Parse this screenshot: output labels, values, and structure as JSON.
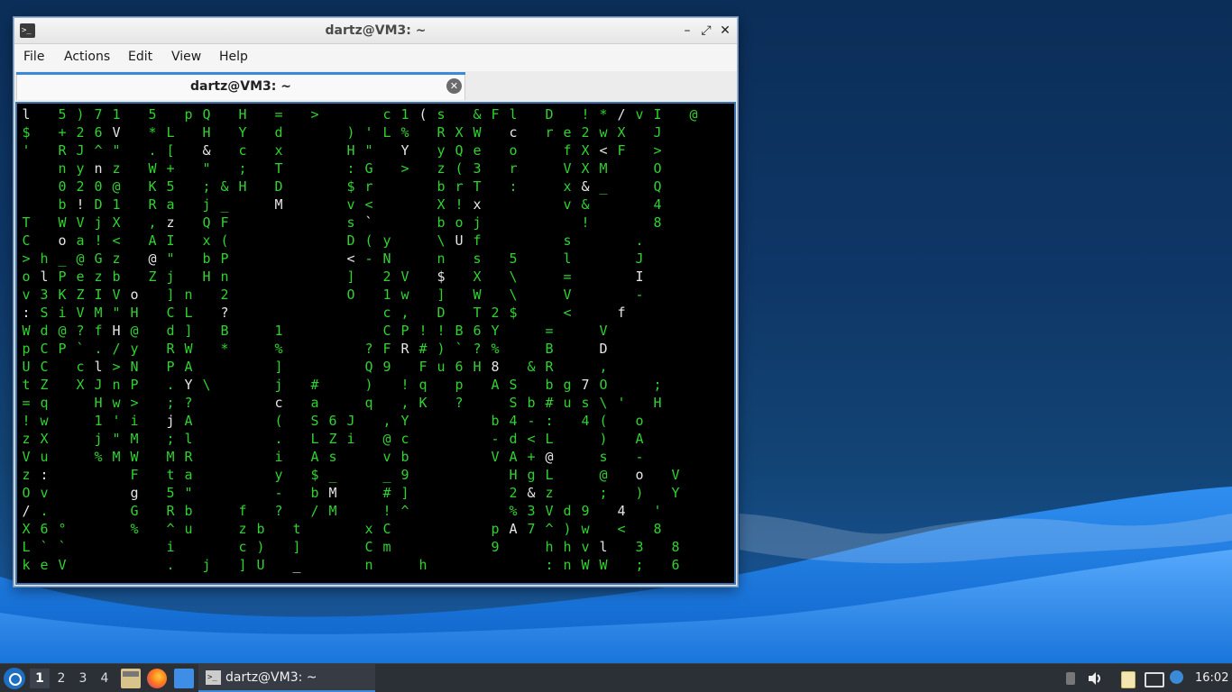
{
  "window": {
    "title": "dartz@VM3: ~",
    "minimize_icon": "minimize-icon",
    "maximize_icon": "maximize-icon",
    "close_icon": "close-icon"
  },
  "menubar": {
    "items": [
      "File",
      "Actions",
      "Edit",
      "View",
      "Help"
    ]
  },
  "tab": {
    "label": "dartz@VM3: ~",
    "close_icon": "tab-close-icon"
  },
  "terminal": {
    "program": "cmatrix",
    "colors": {
      "background": "#000000",
      "green": "#2fd32f",
      "bright": "#e6e6e6"
    },
    "rows": [
      "l 5)71 5 pQ H = >   c1(s &Fl D !*/vI @",
      "$ +26V *L H Y d   )'L% RXW c re2wX J",
      "' RJ^\" .[ & c x   H\" Y yQe o  fX<F >",
      "  nynz W+ \" ; T   :G > z(3 r  VXM  O",
      "  020@ K5 ;&H D   $r   brT :  x&_  Q",
      "  b!D1 Ra j_  M   v<   X!x    v&   4",
      "T WVjX ,z QF      s`   boj     !   8",
      "C oa!< AI x(      D(y  \\Uf    s   .",
      ">h_@Gz @\" bP      <-N  n s 5  l   J",
      "olPezb Zj Hn      ] 2V $ X \\  =   I",
      "v3KZIVo ]n 2      O 1w ] W \\  V   -",
      ":SiVM\"H CL ?        c, D T2$  <  f",
      "Wd@?fH@ d] B  1     CP!!B6Y  =  V",
      "pCP`./y RW *  %    ?FR#)`?%  B  D",
      "UC cl>N PA    ]    Q9 Fu6H8 &R  ,",
      "tZ XJnP .Y\\   j #  ) !q p AS bg7O  ;",
      "=q  Hw> ;?    c a  q ,K ?  Sb#us\\' H",
      "!w  1'i jA    ( S6J ,Y    b4-: 4( o",
      "zX  j\"M ;l    . LZi @c    -d<L  ) A",
      "Vu  %MW MR    i As  vb    VA+@  s -",
      "z:    F ta    y $_  _9     HgL  @ o V",
      "Ov    g 5\"    - bM  #]     2&z  ; ) Y",
      "/.    G Rb  f ? /M  !^     %3Vd9 4 '",
      "X6°   % ^u  zb t   xC     pA7^)w < 8",
      "L``     i   c) ]   Cm     9  hhvl 3 8",
      "keV     . j ]U _   n  h      :nWW ; 6"
    ]
  },
  "taskbar": {
    "start_icon": "lubuntu-start-icon",
    "workspaces": [
      "1",
      "2",
      "3",
      "4"
    ],
    "active_workspace": "1",
    "launchers": [
      "file-manager-icon",
      "firefox-icon",
      "show-desktop-icon"
    ],
    "task_label": "dartz@VM3: ~",
    "tray_icons": [
      "usb-icon",
      "volume-icon",
      "clipboard-icon",
      "network-icon",
      "update-notifier-icon"
    ],
    "clock": "16:02"
  },
  "theme": {
    "accent": "#3b8ad8",
    "desktop_top": "#0b2e58",
    "desktop_wave": "#1f7be0"
  }
}
